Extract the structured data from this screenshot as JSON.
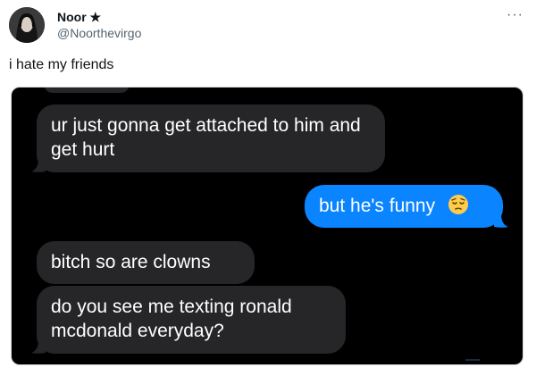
{
  "tweet": {
    "author_name": "Noor ★",
    "author_handle": "@Noorthevirgo",
    "more_icon": "more-horizontal-icon",
    "text": "i hate my friends"
  },
  "conversation": {
    "messages": [
      {
        "from": "friend",
        "text": "ur just gonna get attached to him and get hurt"
      },
      {
        "from": "me",
        "text": "but he's funny",
        "emoji": "pensive-face-emoji"
      },
      {
        "from": "friend",
        "text": "bitch so are clowns"
      },
      {
        "from": "friend",
        "text": "do you see me texting ronald mcdonald everyday?"
      }
    ]
  },
  "colors": {
    "received_bubble": "#262629",
    "sent_bubble": "#0a84ff",
    "chat_background": "#000000"
  }
}
